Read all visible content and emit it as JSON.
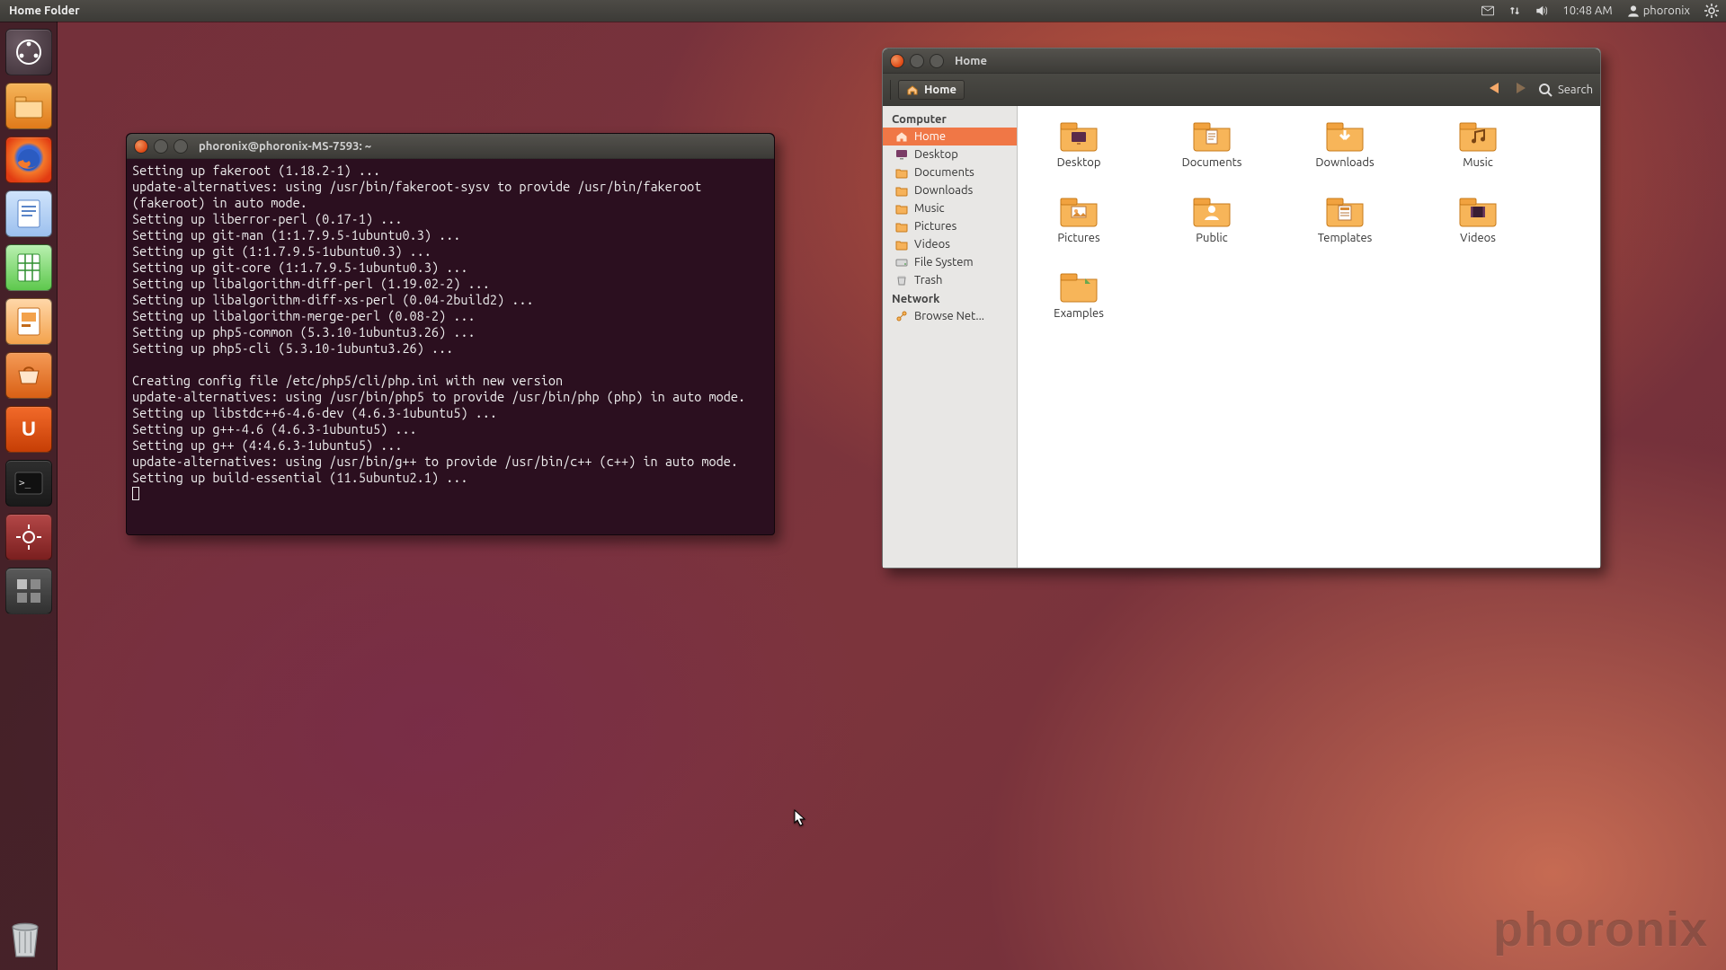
{
  "topbar": {
    "title": "Home Folder",
    "time": "10:48 AM",
    "user": "phoronix"
  },
  "launcher": {
    "items": [
      {
        "name": "dash-home-icon"
      },
      {
        "name": "files-icon"
      },
      {
        "name": "firefox-icon"
      },
      {
        "name": "libreoffice-writer-icon"
      },
      {
        "name": "libreoffice-calc-icon"
      },
      {
        "name": "libreoffice-impress-icon"
      },
      {
        "name": "software-center-icon"
      },
      {
        "name": "ubuntu-one-icon"
      },
      {
        "name": "terminal-icon"
      },
      {
        "name": "system-settings-icon"
      },
      {
        "name": "workspace-switcher-icon"
      }
    ],
    "trash": "trash-icon"
  },
  "terminal": {
    "title": "phoronix@phoronix-MS-7593: ~",
    "lines": [
      "Setting up fakeroot (1.18.2-1) ...",
      "update-alternatives: using /usr/bin/fakeroot-sysv to provide /usr/bin/fakeroot (fakeroot) in auto mode.",
      "Setting up liberror-perl (0.17-1) ...",
      "Setting up git-man (1:1.7.9.5-1ubuntu0.3) ...",
      "Setting up git (1:1.7.9.5-1ubuntu0.3) ...",
      "Setting up git-core (1:1.7.9.5-1ubuntu0.3) ...",
      "Setting up libalgorithm-diff-perl (1.19.02-2) ...",
      "Setting up libalgorithm-diff-xs-perl (0.04-2build2) ...",
      "Setting up libalgorithm-merge-perl (0.08-2) ...",
      "Setting up php5-common (5.3.10-1ubuntu3.26) ...",
      "Setting up php5-cli (5.3.10-1ubuntu3.26) ...",
      "",
      "Creating config file /etc/php5/cli/php.ini with new version",
      "update-alternatives: using /usr/bin/php5 to provide /usr/bin/php (php) in auto mode.",
      "Setting up libstdc++6-4.6-dev (4.6.3-1ubuntu5) ...",
      "Setting up g++-4.6 (4.6.3-1ubuntu5) ...",
      "Setting up g++ (4:4.6.3-1ubuntu5) ...",
      "update-alternatives: using /usr/bin/g++ to provide /usr/bin/c++ (c++) in auto mode.",
      "Setting up build-essential (11.5ubuntu2.1) ..."
    ]
  },
  "nautilus": {
    "title": "Home",
    "crumb": "Home",
    "search": "Search",
    "sidebar": {
      "computer_header": "Computer",
      "network_header": "Network",
      "computer": [
        {
          "label": "Home",
          "icon": "home-icon",
          "active": true
        },
        {
          "label": "Desktop",
          "icon": "desktop-icon",
          "active": false
        },
        {
          "label": "Documents",
          "icon": "folder-icon",
          "active": false
        },
        {
          "label": "Downloads",
          "icon": "folder-icon",
          "active": false
        },
        {
          "label": "Music",
          "icon": "folder-icon",
          "active": false
        },
        {
          "label": "Pictures",
          "icon": "folder-icon",
          "active": false
        },
        {
          "label": "Videos",
          "icon": "folder-icon",
          "active": false
        },
        {
          "label": "File System",
          "icon": "drive-icon",
          "active": false
        },
        {
          "label": "Trash",
          "icon": "trash-icon",
          "active": false
        }
      ],
      "network": [
        {
          "label": "Browse Net...",
          "icon": "network-icon",
          "active": false
        }
      ]
    },
    "pane": [
      {
        "label": "Desktop",
        "icon": "folder-desktop-icon"
      },
      {
        "label": "Documents",
        "icon": "folder-docs-icon"
      },
      {
        "label": "Downloads",
        "icon": "folder-down-icon"
      },
      {
        "label": "Music",
        "icon": "folder-music-icon"
      },
      {
        "label": "Pictures",
        "icon": "folder-pics-icon"
      },
      {
        "label": "Public",
        "icon": "folder-public-icon"
      },
      {
        "label": "Templates",
        "icon": "folder-templ-icon"
      },
      {
        "label": "Videos",
        "icon": "folder-video-icon"
      },
      {
        "label": "Examples",
        "icon": "folder-examples-icon"
      }
    ]
  },
  "watermark": "phoronix"
}
